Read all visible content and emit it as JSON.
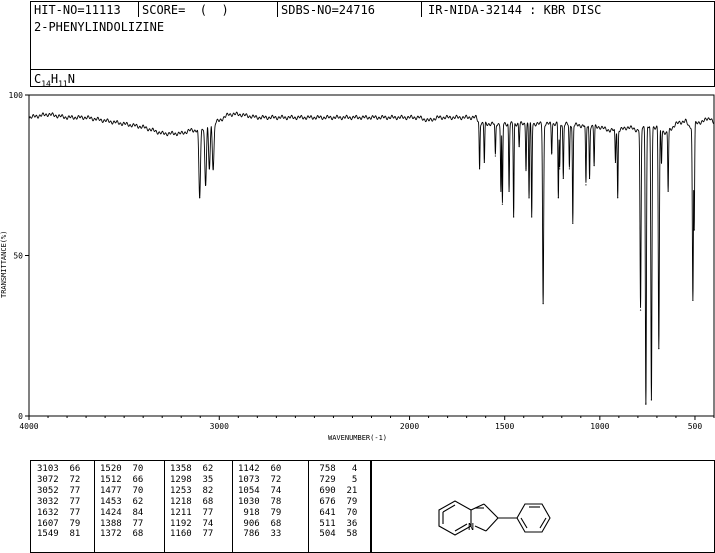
{
  "header": {
    "hit_no": "HIT-NO=11113",
    "score": "SCORE=  (  )",
    "sdbs_no": "SDBS-NO=24716",
    "ir_info": "IR-NIDA-32144 : KBR DISC"
  },
  "compound": {
    "name": "2-PHENYLINDOLIZINE",
    "formula_c": "C",
    "formula_c_sub": "14",
    "formula_h": "H",
    "formula_h_sub": "11",
    "formula_n": "N"
  },
  "chart_data": {
    "type": "line",
    "xlabel": "WAVENUMBER(-1)",
    "ylabel": "TRANSMITTANCE(%)",
    "xlim": [
      4000,
      400
    ],
    "ylim": [
      0,
      100
    ],
    "x_reversed": true,
    "x_ticks": [
      4000,
      3000,
      2000,
      1500,
      1000,
      500
    ],
    "y_ticks": [
      0,
      50,
      100
    ],
    "x_tick_labels": [
      "4000",
      "3000",
      "2000",
      "1500",
      "1000",
      "500"
    ],
    "y_tick_labels": [
      "0",
      "50",
      "100"
    ],
    "baseline": [
      [
        4000,
        93
      ],
      [
        3900,
        94
      ],
      [
        3800,
        93
      ],
      [
        3700,
        93
      ],
      [
        3600,
        92
      ],
      [
        3500,
        91
      ],
      [
        3400,
        90
      ],
      [
        3300,
        88
      ],
      [
        3200,
        88
      ],
      [
        3150,
        89
      ],
      [
        3120,
        89
      ],
      [
        3000,
        92
      ],
      [
        2950,
        94
      ],
      [
        2900,
        94
      ],
      [
        2800,
        93
      ],
      [
        2700,
        93
      ],
      [
        2600,
        93
      ],
      [
        2500,
        93
      ],
      [
        2400,
        93
      ],
      [
        2300,
        93
      ],
      [
        2200,
        93
      ],
      [
        2100,
        93
      ],
      [
        2050,
        93
      ],
      [
        1950,
        93
      ],
      [
        1900,
        92
      ],
      [
        1850,
        93
      ],
      [
        1800,
        93
      ],
      [
        1750,
        93
      ],
      [
        1700,
        93
      ],
      [
        1650,
        93
      ],
      [
        1640,
        92
      ],
      [
        1620,
        91
      ],
      [
        1600,
        91
      ],
      [
        1400,
        91
      ],
      [
        1200,
        91
      ],
      [
        1000,
        90
      ],
      [
        950,
        89
      ],
      [
        900,
        89
      ],
      [
        850,
        90
      ],
      [
        800,
        89
      ],
      [
        780,
        90
      ],
      [
        700,
        90
      ],
      [
        650,
        88
      ],
      [
        600,
        91
      ],
      [
        550,
        92
      ],
      [
        530,
        90
      ],
      [
        500,
        91
      ],
      [
        450,
        92
      ],
      [
        420,
        93
      ],
      [
        400,
        91
      ]
    ],
    "peaks": [
      {
        "x": 3103,
        "y": 68
      },
      {
        "x": 3072,
        "y": 72
      },
      {
        "x": 3052,
        "y": 77
      },
      {
        "x": 3032,
        "y": 77
      },
      {
        "x": 1632,
        "y": 77
      },
      {
        "x": 1607,
        "y": 79
      },
      {
        "x": 1549,
        "y": 81
      },
      {
        "x": 1520,
        "y": 70
      },
      {
        "x": 1512,
        "y": 66
      },
      {
        "x": 1477,
        "y": 70
      },
      {
        "x": 1453,
        "y": 62
      },
      {
        "x": 1424,
        "y": 84
      },
      {
        "x": 1388,
        "y": 77
      },
      {
        "x": 1372,
        "y": 68
      },
      {
        "x": 1358,
        "y": 62
      },
      {
        "x": 1298,
        "y": 35
      },
      {
        "x": 1253,
        "y": 82
      },
      {
        "x": 1218,
        "y": 68
      },
      {
        "x": 1211,
        "y": 77
      },
      {
        "x": 1192,
        "y": 74
      },
      {
        "x": 1160,
        "y": 77
      },
      {
        "x": 1142,
        "y": 60
      },
      {
        "x": 1073,
        "y": 72
      },
      {
        "x": 1054,
        "y": 74
      },
      {
        "x": 1030,
        "y": 78
      },
      {
        "x": 918,
        "y": 79
      },
      {
        "x": 906,
        "y": 68
      },
      {
        "x": 786,
        "y": 33
      },
      {
        "x": 758,
        "y": 4
      },
      {
        "x": 729,
        "y": 5
      },
      {
        "x": 690,
        "y": 21
      },
      {
        "x": 676,
        "y": 79
      },
      {
        "x": 641,
        "y": 70
      },
      {
        "x": 511,
        "y": 36
      },
      {
        "x": 504,
        "y": 58
      }
    ]
  },
  "peak_table": {
    "columns": [
      [
        "3103  66",
        "3072  72",
        "3052  77",
        "3032  77",
        "1632  77",
        "1607  79",
        "1549  81"
      ],
      [
        "1520  70",
        "1512  66",
        "1477  70",
        "1453  62",
        "1424  84",
        "1388  77",
        "1372  68"
      ],
      [
        "1358  62",
        "1298  35",
        "1253  82",
        "1218  68",
        "1211  77",
        "1192  74",
        "1160  77"
      ],
      [
        "1142  60",
        "1073  72",
        "1054  74",
        "1030  78",
        " 918  79",
        " 906  68",
        " 786  33"
      ],
      [
        " 758   4",
        " 729   5",
        " 690  21",
        " 676  79",
        " 641  70",
        " 511  36",
        " 504  58"
      ]
    ]
  },
  "structure": {
    "icon": "chemical-structure-2-phenylindolizine",
    "atom_label": "N"
  }
}
